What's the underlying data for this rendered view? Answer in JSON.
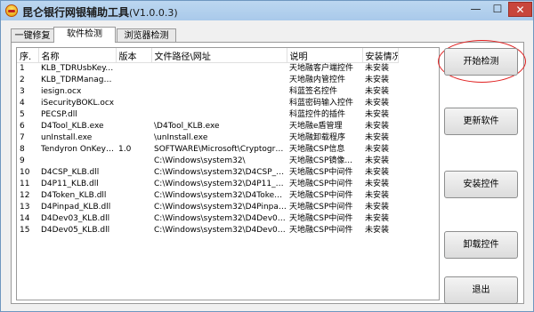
{
  "window": {
    "title": "昆仑银行网银辅助工具",
    "version": "(V1.0.0.3)",
    "minimize_glyph": "—",
    "maximize_glyph": "☐",
    "close_glyph": "✕",
    "close_color": "#c8463b"
  },
  "tabs": [
    {
      "label": "一键修复",
      "active": false
    },
    {
      "label": "软件检测",
      "active": true
    },
    {
      "label": "浏览器检测",
      "active": false
    }
  ],
  "table": {
    "headers": [
      "序.",
      "名称",
      "版本",
      "文件路径\\网址",
      "说明",
      "安装情况"
    ],
    "rows": [
      [
        "1",
        "KLB_TDRUsbKey.dll",
        "",
        "",
        "天地融客户端控件",
        "未安装"
      ],
      [
        "2",
        "KLB_TDRManage.dll",
        "",
        "",
        "天地融内管控件",
        "未安装"
      ],
      [
        "3",
        "iesign.ocx",
        "",
        "",
        "科蓝签名控件",
        "未安装"
      ],
      [
        "4",
        "iSecurityBOKL.ocx",
        "",
        "",
        "科蓝密码输入控件",
        "未安装"
      ],
      [
        "5",
        "PECSP.dll",
        "",
        "",
        "科蓝控件的插件",
        "未安装"
      ],
      [
        "6",
        "D4Tool_KLB.exe",
        "",
        "\\D4Tool_KLB.exe",
        "天地融e盾管理",
        "未安装"
      ],
      [
        "7",
        "unInstall.exe",
        "",
        "\\unInstall.exe",
        "天地融卸载程序",
        "未安装"
      ],
      [
        "8",
        "Tendyron OnKey ...",
        "1.0",
        "SOFTWARE\\Microsoft\\Cryptography...",
        "天地融CSP信息",
        "未安装"
      ],
      [
        "9",
        "",
        "",
        "C:\\Windows\\system32\\",
        "天地融CSP镜像...",
        "未安装"
      ],
      [
        "10",
        "D4CSP_KLB.dll",
        "",
        "C:\\Windows\\system32\\D4CSP_KLB.dll",
        "天地融CSP中间件",
        "未安装"
      ],
      [
        "11",
        "D4P11_KLB.dll",
        "",
        "C:\\Windows\\system32\\D4P11_KLB.dll",
        "天地融CSP中间件",
        "未安装"
      ],
      [
        "12",
        "D4Token_KLB.dll",
        "",
        "C:\\Windows\\system32\\D4Token_KL...",
        "天地融CSP中间件",
        "未安装"
      ],
      [
        "13",
        "D4Pinpad_KLB.dll",
        "",
        "C:\\Windows\\system32\\D4Pinpad_KL...",
        "天地融CSP中间件",
        "未安装"
      ],
      [
        "14",
        "D4Dev03_KLB.dll",
        "",
        "C:\\Windows\\system32\\D4Dev03_KLB...",
        "天地融CSP中间件",
        "未安装"
      ],
      [
        "15",
        "D4Dev05_KLB.dll",
        "",
        "C:\\Windows\\system32\\D4Dev05_KLB...",
        "天地融CSP中间件",
        "未安装"
      ]
    ]
  },
  "buttons": {
    "start_check": "开始检测",
    "update_software": "更新软件",
    "install_controls": "安装控件",
    "uninstall_controls": "卸载控件",
    "exit": "退出"
  }
}
